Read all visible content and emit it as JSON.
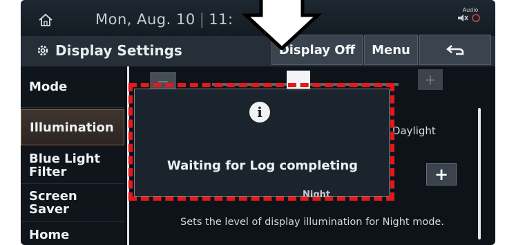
{
  "status": {
    "date": "Mon, Aug. 10",
    "time": "11:",
    "audio_label": "Audio"
  },
  "header": {
    "title": "Display Settings",
    "display_off_label": "Display Off",
    "menu_label": "Menu"
  },
  "sidebar": {
    "items": [
      {
        "label": "Mode"
      },
      {
        "label": "Illumination"
      },
      {
        "label": "Blue Light Filter"
      },
      {
        "label": "Screen Saver"
      },
      {
        "label": "Home"
      }
    ]
  },
  "content": {
    "minus_label": "−",
    "plus_label": "+",
    "daylight_text": "r Daylight",
    "night_label": "Night",
    "night_description": "Sets the level of display illumination for Night mode."
  },
  "popup": {
    "icon": "i",
    "message": "Waiting for Log completing"
  },
  "colors": {
    "annotation_red": "#e5181a",
    "background": "#0d1319"
  }
}
